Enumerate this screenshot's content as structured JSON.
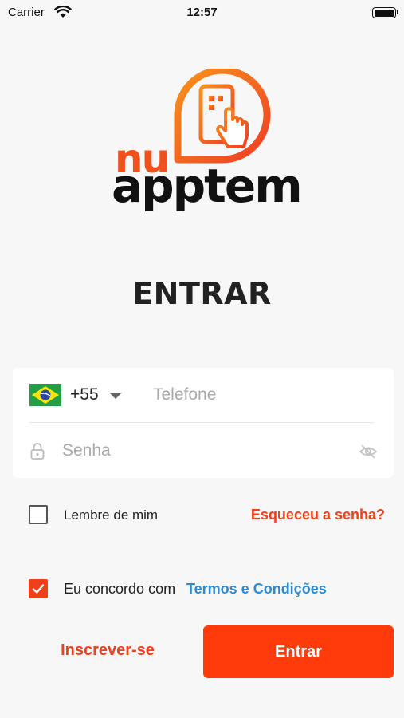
{
  "status_bar": {
    "carrier": "Carrier",
    "time": "12:57"
  },
  "logo": {
    "line1": "nu",
    "line2": "apptem",
    "accent": "#f0501c"
  },
  "title": "ENTRAR",
  "form": {
    "country": {
      "flag": "brazil-flag",
      "code": "+55"
    },
    "phone": {
      "placeholder": "Telefone",
      "value": ""
    },
    "password": {
      "placeholder": "Senha",
      "value": ""
    }
  },
  "remember": {
    "label": "Lembre de mim",
    "checked": false
  },
  "forgot_link": "Esqueceu a senha?",
  "terms": {
    "prefix": "Eu concordo com",
    "link": "Termos e Condições",
    "checked": true
  },
  "actions": {
    "signup": "Inscrever-se",
    "submit": "Entrar"
  },
  "colors": {
    "primary": "#ff3b0c",
    "link": "#2a8ad4"
  }
}
